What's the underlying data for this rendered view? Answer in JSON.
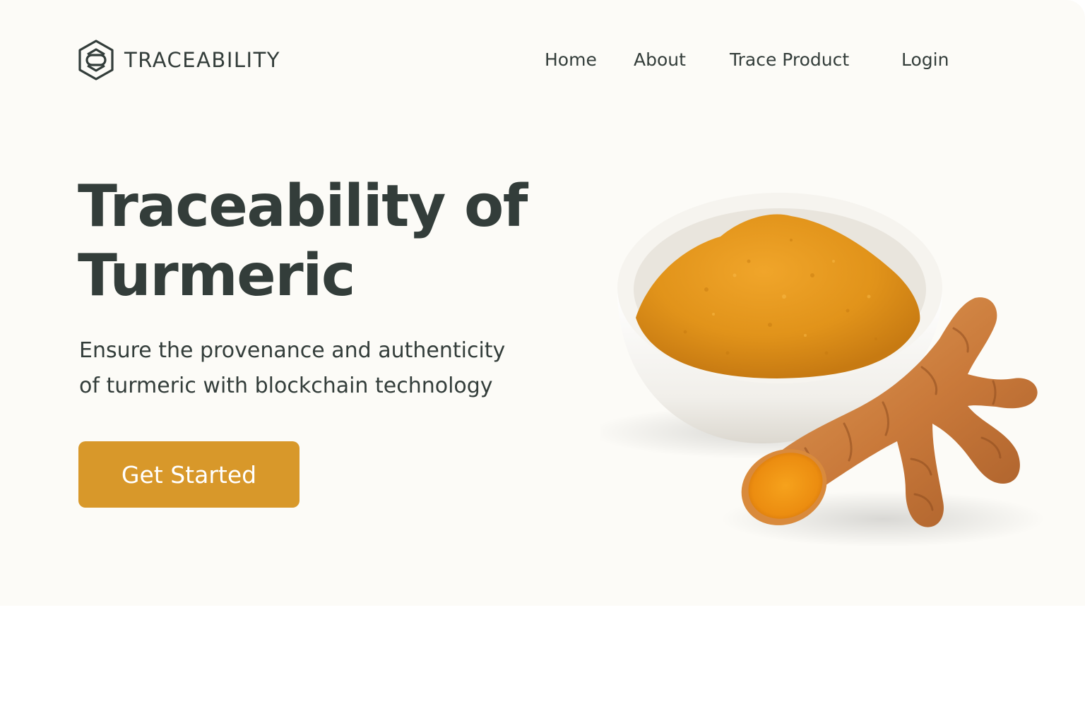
{
  "brand": {
    "name": "TRACEABILITY",
    "logo_icon": "hexagon-link-icon"
  },
  "nav": {
    "items": [
      {
        "label": "Home"
      },
      {
        "label": "About"
      },
      {
        "label": "Trace Product"
      },
      {
        "label": "Login"
      }
    ]
  },
  "hero": {
    "title_line1": "Traceability of",
    "title_line2": "Turmeric",
    "subtitle_line1": "Ensure the provenance and authenticity",
    "subtitle_line2": "of turmeric with blockchain technology",
    "cta_label": "Get Started",
    "image_icon": "turmeric-powder-and-root-image"
  },
  "colors": {
    "text": "#333d3a",
    "accent": "#d8982a",
    "hero_bg": "#fcfbf7",
    "turmeric": "#e39a1c"
  }
}
